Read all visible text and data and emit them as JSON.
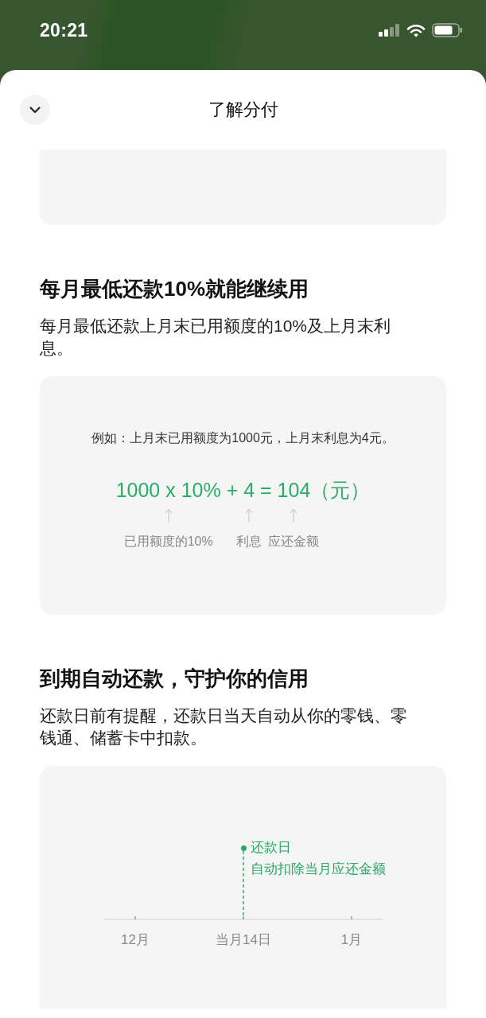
{
  "status_bar": {
    "time": "20:21"
  },
  "header": {
    "title": "了解分付"
  },
  "sections": [
    {
      "card": {
        "kind": "blank"
      }
    },
    {
      "heading": "每月最低还款10%就能继续用",
      "text": "每月最低还款上月末已用额度的10%及上月末利息。",
      "card": {
        "kind": "example",
        "intro": "例如：上月末已用额度为1000元，上月末利息为4元。",
        "formula": [
          {
            "text": "1000 x 10%",
            "note": "已用额度的10%"
          },
          {
            "text": " + "
          },
          {
            "text": "4",
            "note": "利息"
          },
          {
            "text": " = "
          },
          {
            "text": "104",
            "note": "应还金额"
          },
          {
            "text": "（元）"
          }
        ]
      }
    },
    {
      "heading": "到期自动还款，守护你的信用",
      "text": "还款日前有提醒，还款日当天自动从你的零钱、零钱通、储蓄卡中扣款。",
      "card": {
        "kind": "timeline",
        "ticks": [
          {
            "label": "12月"
          },
          {
            "label": "当月14日",
            "event": {
              "title": "还款日",
              "detail": "自动扣除当月应还金额"
            }
          },
          {
            "label": "1月"
          }
        ]
      }
    }
  ]
}
